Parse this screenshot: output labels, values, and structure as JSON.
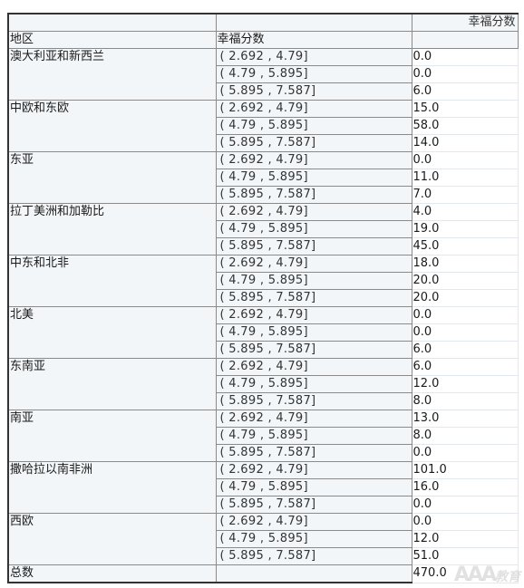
{
  "table": {
    "header_top": {
      "col3": "幸福分数"
    },
    "header_second": {
      "col1": "地区",
      "col2": "幸福分数"
    },
    "groups": [
      {
        "region": "澳大利亚和新西兰",
        "rows": [
          {
            "bin": "( 2.692 , 4.79]",
            "value": "0.0"
          },
          {
            "bin": "( 4.79 , 5.895]",
            "value": "0.0"
          },
          {
            "bin": "( 5.895 , 7.587]",
            "value": "6.0"
          }
        ]
      },
      {
        "region": "中欧和东欧",
        "rows": [
          {
            "bin": "( 2.692 , 4.79]",
            "value": "15.0"
          },
          {
            "bin": "( 4.79 , 5.895]",
            "value": "58.0"
          },
          {
            "bin": "( 5.895 , 7.587]",
            "value": "14.0"
          }
        ]
      },
      {
        "region": "东亚",
        "rows": [
          {
            "bin": "( 2.692 , 4.79]",
            "value": "0.0"
          },
          {
            "bin": "( 4.79 , 5.895]",
            "value": "11.0"
          },
          {
            "bin": "( 5.895 , 7.587]",
            "value": "7.0"
          }
        ]
      },
      {
        "region": "拉丁美洲和加勒比",
        "rows": [
          {
            "bin": "( 2.692 , 4.79]",
            "value": "4.0"
          },
          {
            "bin": "( 4.79 , 5.895]",
            "value": "19.0"
          },
          {
            "bin": "( 5.895 , 7.587]",
            "value": "45.0"
          }
        ]
      },
      {
        "region": "中东和北非",
        "rows": [
          {
            "bin": "( 2.692 , 4.79]",
            "value": "18.0"
          },
          {
            "bin": "( 4.79 , 5.895]",
            "value": "20.0"
          },
          {
            "bin": "( 5.895 , 7.587]",
            "value": "20.0"
          }
        ]
      },
      {
        "region": "北美",
        "rows": [
          {
            "bin": "( 2.692 , 4.79]",
            "value": "0.0"
          },
          {
            "bin": "( 4.79 , 5.895]",
            "value": "0.0"
          },
          {
            "bin": "( 5.895 , 7.587]",
            "value": "6.0"
          }
        ]
      },
      {
        "region": "东南亚",
        "rows": [
          {
            "bin": "( 2.692 , 4.79]",
            "value": "6.0"
          },
          {
            "bin": "( 4.79 , 5.895]",
            "value": "12.0"
          },
          {
            "bin": "( 5.895 , 7.587]",
            "value": "8.0"
          }
        ]
      },
      {
        "region": "南亚",
        "rows": [
          {
            "bin": "( 2.692 , 4.79]",
            "value": "13.0"
          },
          {
            "bin": "( 4.79 , 5.895]",
            "value": "8.0"
          },
          {
            "bin": "( 5.895 , 7.587]",
            "value": "0.0"
          }
        ]
      },
      {
        "region": "撒哈拉以南非洲",
        "rows": [
          {
            "bin": "( 2.692 , 4.79]",
            "value": "101.0"
          },
          {
            "bin": "( 4.79 , 5.895]",
            "value": "16.0"
          },
          {
            "bin": "( 5.895 , 7.587]",
            "value": "0.0"
          }
        ]
      },
      {
        "region": "西欧",
        "rows": [
          {
            "bin": "( 2.692 , 4.79]",
            "value": "0.0"
          },
          {
            "bin": "( 4.79 , 5.895]",
            "value": "12.0"
          },
          {
            "bin": "( 5.895 , 7.587]",
            "value": "51.0"
          }
        ]
      }
    ],
    "total": {
      "label": "总数",
      "value": "470.0"
    }
  },
  "watermark": {
    "text": "AAA",
    "sub": "教育"
  }
}
